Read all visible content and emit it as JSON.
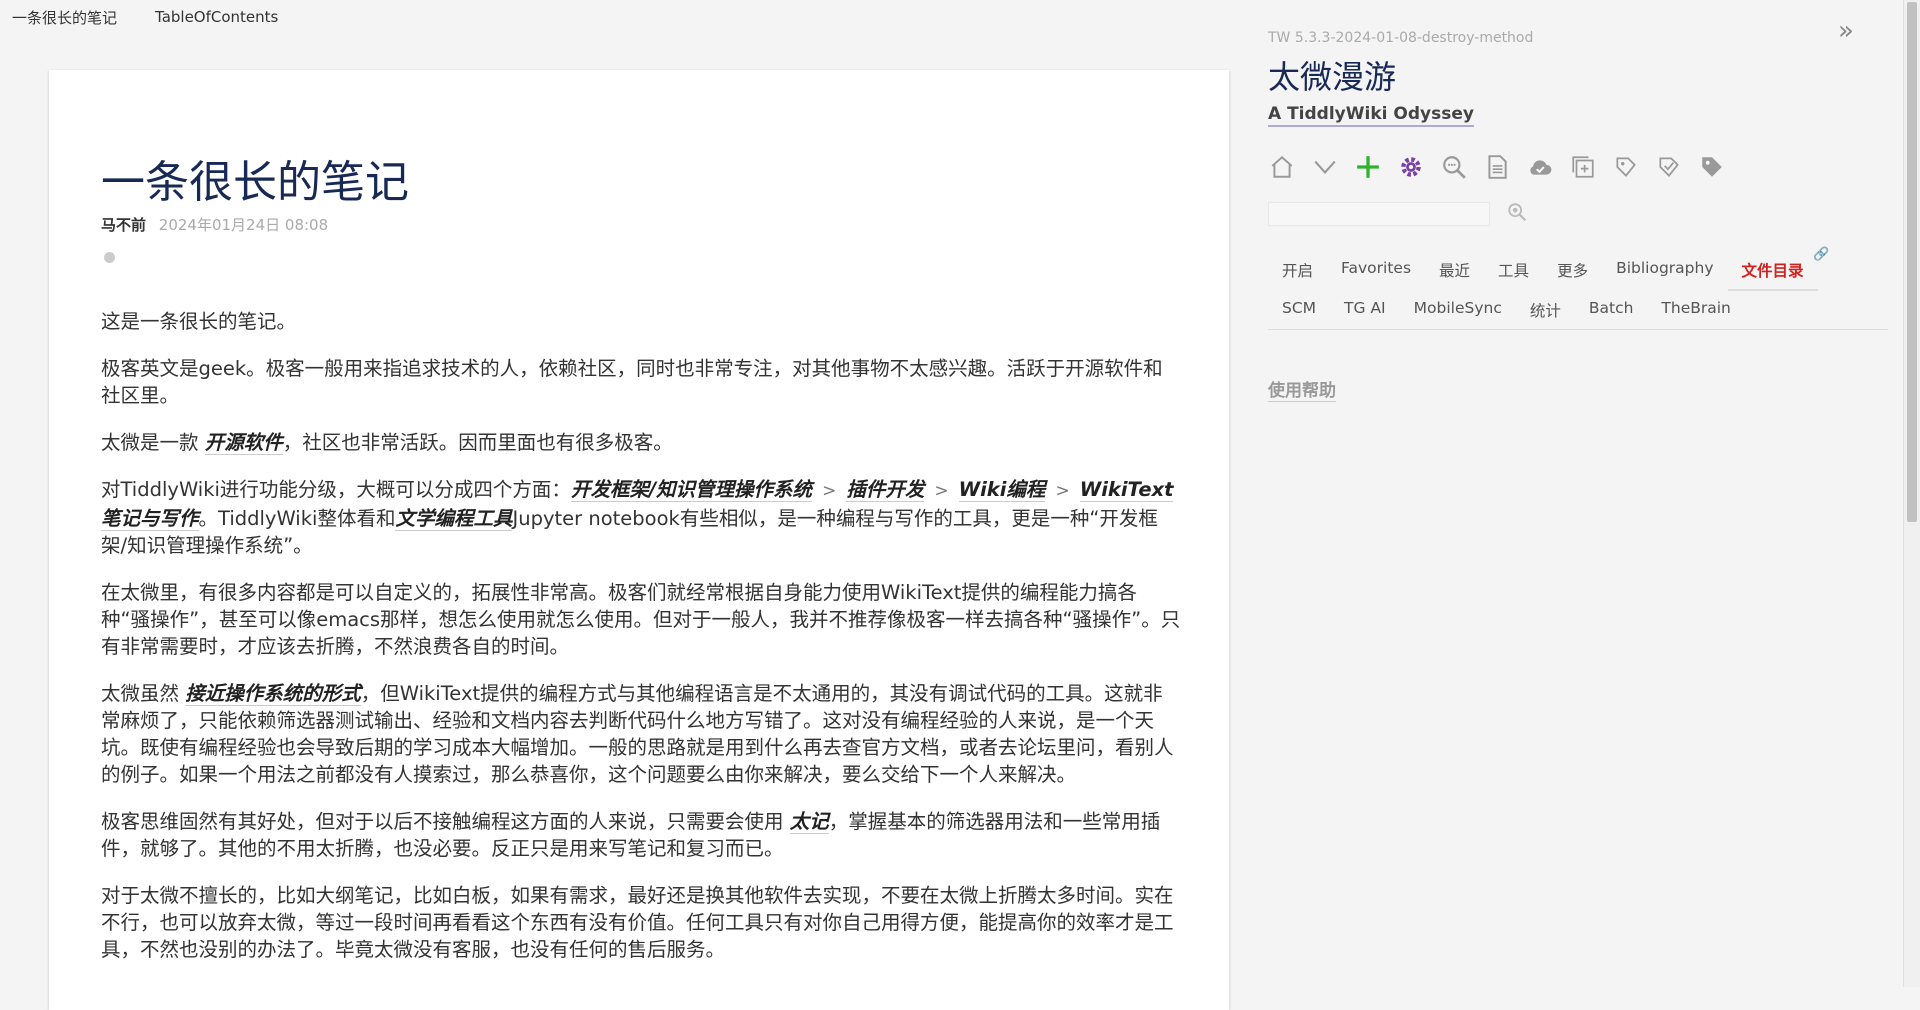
{
  "topbar": {
    "items": [
      "一条很长的笔记",
      "TableOfContents"
    ]
  },
  "tiddler": {
    "title": "一条很长的笔记",
    "author": "马不前",
    "date": "2024年01月24日 08:08",
    "paragraphs": {
      "p1": "这是一条很长的笔记。",
      "p2": "极客英文是geek。极客一般用来指追求技术的人，依赖社区，同时也非常专注，对其他事物不太感兴趣。活跃于开源软件和社区里。",
      "p3a": "太微是一款 ",
      "p3link": "开源软件",
      "p3b": "，社区也非常活跃。因而里面也有很多极客。",
      "p4a": "对TiddlyWiki进行功能分级，大概可以分成四个方面：",
      "p4l1": "开发框架/知识管理操作系统",
      "p4gt": ">",
      "p4l2": "插件开发",
      "p4l3": "Wiki编程",
      "p4l4": "WikiText笔记与写作",
      "p4b": "。TiddlyWiki整体看和",
      "p4l5": "文学编程工具",
      "p4c": "Jupyter notebook有些相似，是一种编程与写作的工具，更是一种“开发框架/知识管理操作系统”。",
      "p5": "在太微里，有很多内容都是可以自定义的，拓展性非常高。极客们就经常根据自身能力使用WikiText提供的编程能力搞各种“骚操作”，甚至可以像emacs那样，想怎么使用就怎么使用。但对于一般人，我并不推荐像极客一样去搞各种“骚操作”。只有非常需要时，才应该去折腾，不然浪费各自的时间。",
      "p6a": "太微虽然 ",
      "p6link": "接近操作系统的形式",
      "p6b": "，但WikiText提供的编程方式与其他编程语言是不太通用的，其没有调试代码的工具。这就非常麻烦了，只能依赖筛选器测试输出、经验和文档内容去判断代码什么地方写错了。这对没有编程经验的人来说，是一个天坑。既使有编程经验也会导致后期的学习成本大幅增加。一般的思路就是用到什么再去查官方文档，或者去论坛里问，看别人的例子。如果一个用法之前都没有人摸索过，那么恭喜你，这个问题要么由你来解决，要么交给下一个人来解决。",
      "p7a": "极客思维固然有其好处，但对于以后不接触编程这方面的人来说，只需要会使用 ",
      "p7link": "太记",
      "p7b": "，掌握基本的筛选器用法和一些常用插件，就够了。其他的不用太折腾，也没必要。反正只是用来写笔记和复习而已。",
      "p8": "对于太微不擅长的，比如大纲笔记，比如白板，如果有需求，最好还是换其他软件去实现，不要在太微上折腾太多时间。实在不行，也可以放弃太微，等过一段时间再看看这个东西有没有价值。任何工具只有对你自己用得方便，能提高你的效率才是工具，不然也没别的办法了。毕竟太微没有客服，也没有任何的售后服务。"
    }
  },
  "sidebar": {
    "version": "TW 5.3.3-2024-01-08-destroy-method",
    "site_title": "太微漫游",
    "site_subtitle": "A TiddlyWiki Odyssey",
    "search_placeholder": "",
    "tabs_row1": [
      "开启",
      "Favorites",
      "最近",
      "工具",
      "更多",
      "Bibliography",
      "文件目录"
    ],
    "tabs_row2": [
      "SCM",
      "TG AI",
      "MobileSync",
      "统计",
      "Batch",
      "TheBrain"
    ],
    "help": "使用帮助",
    "active_tab_color": "#d0221f"
  },
  "icons": {
    "toolbar": [
      "home-icon",
      "chevron-down-icon",
      "new-tiddler-icon",
      "gear-icon",
      "advanced-search-icon",
      "new-journal-icon",
      "cloud-icon",
      "clone-icon",
      "layout-icon",
      "story-icon",
      "tag-icon"
    ],
    "new_tiddler_color": "#2cb42c",
    "gear_color": "#7a3fa5"
  }
}
